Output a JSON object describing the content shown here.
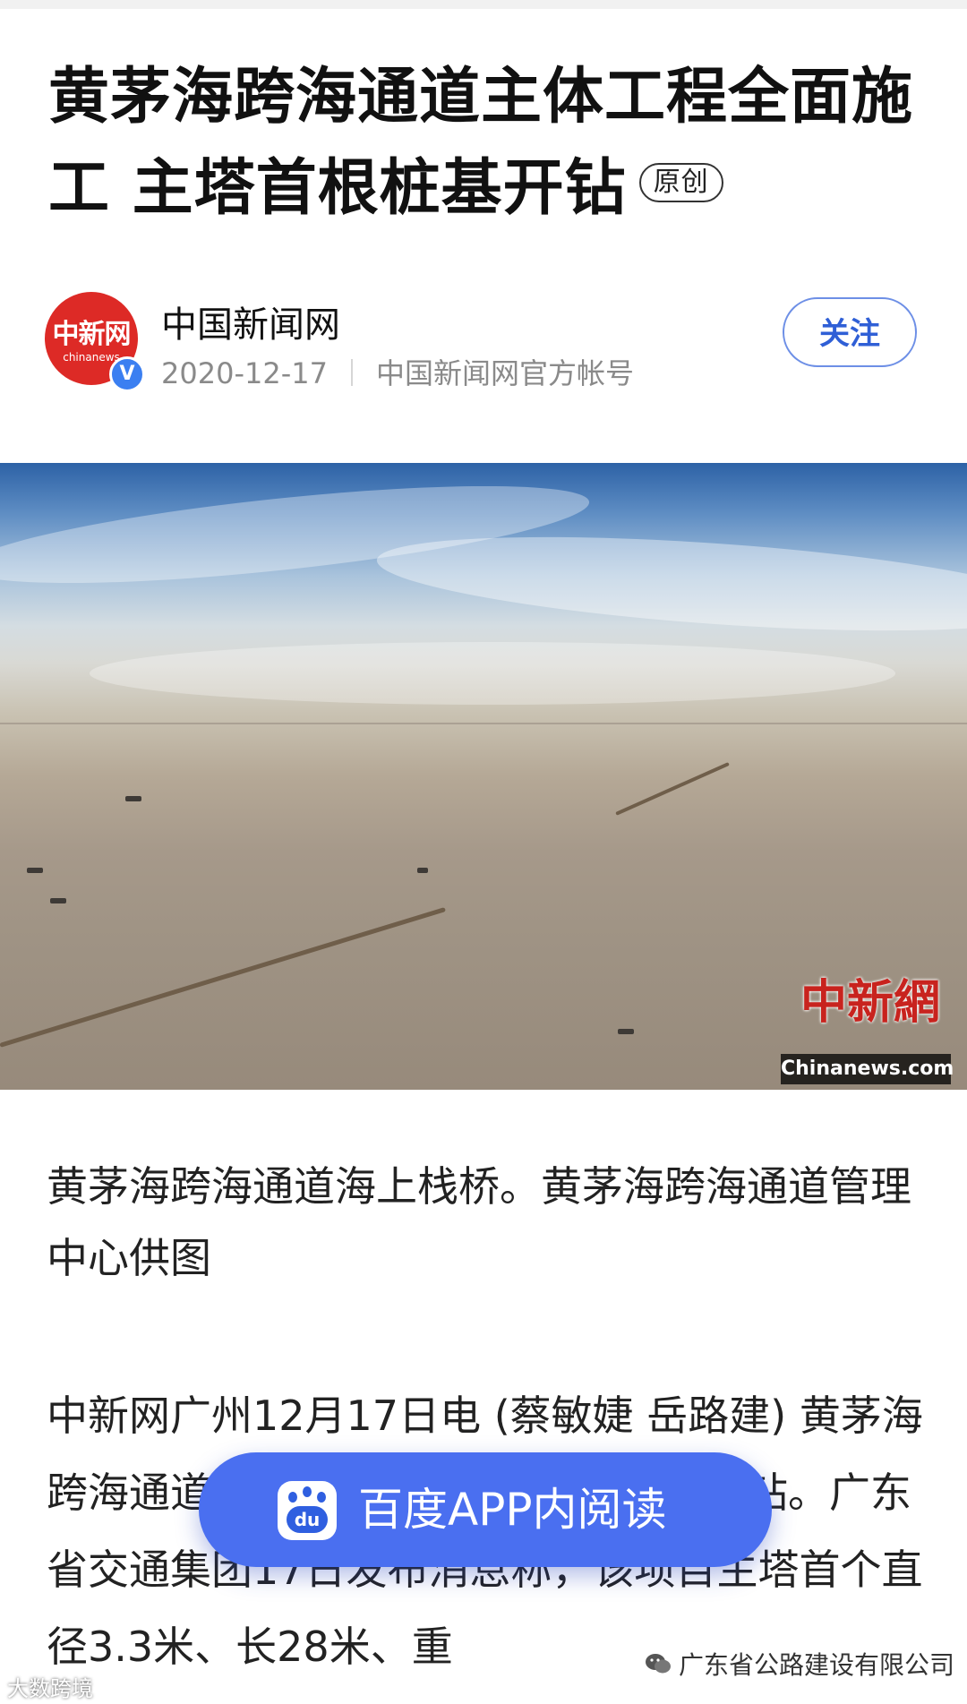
{
  "article": {
    "title": "黄茅海跨海通道主体工程全面施工 主塔首根桩基开钻",
    "badge": "原创"
  },
  "author": {
    "name": "中国新闻网",
    "date": "2020-12-17",
    "account_desc": "中国新闻网官方帐号",
    "follow_label": "关注",
    "avatar_logo_cn": "中新网",
    "avatar_logo_en": "chinanews",
    "verified_mark": "V"
  },
  "photo": {
    "watermark_cn": "中新網",
    "watermark_en": "Chinanews.com"
  },
  "caption": "黄茅海跨海通道海上栈桥。黄茅海跨海通道管理中心供图",
  "body_paragraph": "中新网广州12月17日电 (蔡敏婕 岳路建) 黄茅海跨海通道主体工程主塔首根桩基已经开钻。广东省交通集团17日发布消息称，该项目主塔首个直径3.3米、长28米、重",
  "floating_button": {
    "label": "百度APP内阅读",
    "icon": "baidu-paw-icon",
    "icon_text": "du"
  },
  "footer": {
    "left_watermark": "大数跨境",
    "right_source": "广东省公路建设有限公司"
  },
  "colors": {
    "accent_blue": "#4a6ff0",
    "follow_blue": "#2f5fd6",
    "logo_red": "#dd2a26"
  }
}
